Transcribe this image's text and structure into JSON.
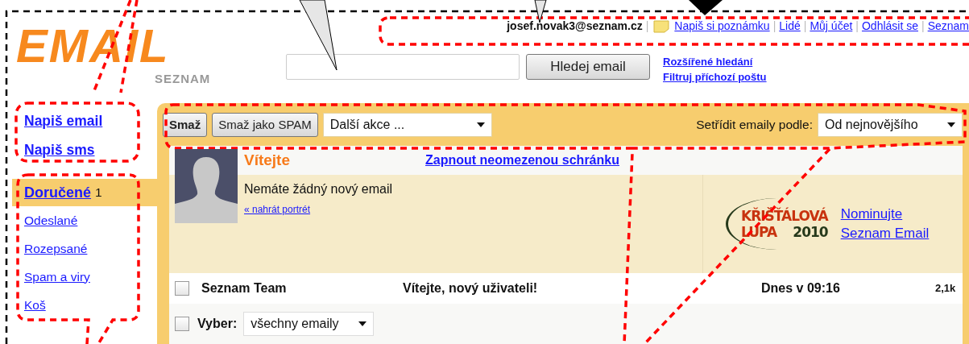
{
  "logo": {
    "title": "EMAIL",
    "subtitle": "SEZNAM"
  },
  "account": {
    "email": "josef.novak3@seznam.cz",
    "separator": "|",
    "links": [
      "Napiš si poznámku",
      "Lidé",
      "Můj účet",
      "Odhlásit se",
      "Seznam"
    ]
  },
  "search": {
    "button": "Hledej email",
    "links": [
      "Rozšířené hledání",
      "Filtruj příchozí poštu"
    ]
  },
  "compose": [
    "Napiš email",
    "Napiš sms"
  ],
  "folders": [
    {
      "label": "Doručené",
      "count": "1",
      "selected": true
    },
    {
      "label": "Odeslané",
      "selected": false
    },
    {
      "label": "Rozepsané",
      "selected": false
    },
    {
      "label": "Spam a viry",
      "selected": false
    },
    {
      "label": "Koš",
      "selected": false
    }
  ],
  "toolbar": {
    "buttons": [
      {
        "label": "Smaž",
        "primary": true
      },
      {
        "label": "Smaž jako SPAM",
        "primary": false
      }
    ],
    "action_select": "Další akce ...",
    "sort_label": "Setřídit emaily podle:",
    "sort_select": "Od nejnovějšího"
  },
  "welcome": {
    "title": "Vítejte",
    "link": "Zapnout neomezenou schránku",
    "message": "Nemáte žádný nový email",
    "portrait_link": "« nahrát portrét"
  },
  "promo": {
    "badge_line1": "KŘIŠŤÁLOVÁ",
    "badge_line2": "LUPA",
    "badge_year": "2010",
    "links": [
      "Nominujte",
      "Seznam Email"
    ]
  },
  "messages": [
    {
      "sender": "Seznam Team",
      "subject": "Vítejte, nový uživateli!",
      "date": "Dnes v 09:16",
      "size": "2,1k",
      "checked": false,
      "unread": true
    }
  ],
  "select_row": {
    "label": "Vyber:",
    "value": "všechny emaily",
    "checked": false
  }
}
